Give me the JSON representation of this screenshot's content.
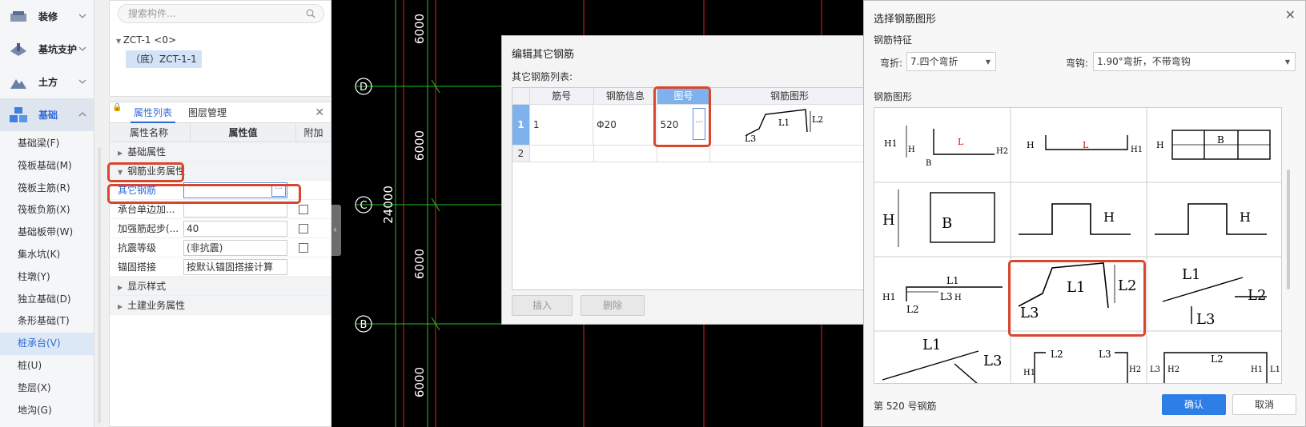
{
  "nav": {
    "categories": [
      {
        "label": "装修",
        "icon": "decoration-icon"
      },
      {
        "label": "基坑支护",
        "icon": "pit-support-icon"
      },
      {
        "label": "土方",
        "icon": "earthwork-icon"
      },
      {
        "label": "基础",
        "icon": "foundation-icon",
        "active": true
      }
    ],
    "items": [
      "基础梁(F)",
      "筏板基础(M)",
      "筏板主筋(R)",
      "筏板负筋(X)",
      "基础板带(W)",
      "集水坑(K)",
      "柱墩(Y)",
      "独立基础(D)",
      "条形基础(T)",
      "桩承台(V)",
      "桩(U)",
      "垫层(X)",
      "地沟(G)"
    ],
    "active_item": "桩承台(V)"
  },
  "tree": {
    "search_placeholder": "搜索构件...",
    "root": "ZCT-1 <0>",
    "child": "（底）ZCT-1-1"
  },
  "props": {
    "tab_attr": "属性列表",
    "tab_layer": "图层管理",
    "col_name": "属性名称",
    "col_value": "属性值",
    "col_add": "附加",
    "group_basic": "基础属性",
    "group_rebar": "钢筋业务属性",
    "rows": {
      "other_rebar": {
        "name": "其它钢筋",
        "value": ""
      },
      "cap_edge": {
        "name": "承台单边加...",
        "value": ""
      },
      "strength_start": {
        "name": "加强筋起步(...",
        "value": "40"
      },
      "seismic": {
        "name": "抗震等级",
        "value": "(非抗震)"
      },
      "anchor": {
        "name": "锚固搭接",
        "value": "按默认锚固搭接计算"
      }
    },
    "group_display": "显示样式",
    "group_civil": "土建业务属性"
  },
  "canvas": {
    "axis_labels": [
      "D",
      "C",
      "B"
    ],
    "dims": [
      "6000",
      "6000",
      "6000",
      "6000"
    ],
    "total_dim": "24000"
  },
  "edit_dialog": {
    "title": "编辑其它钢筋",
    "list_label": "其它钢筋列表:",
    "columns": [
      "筋号",
      "钢筋信息",
      "图号",
      "钢筋图形"
    ],
    "rows": [
      {
        "num": "1",
        "bar_no": "1",
        "info": "Φ20",
        "fig": "520"
      },
      {
        "num": "2",
        "bar_no": "",
        "info": "",
        "fig": ""
      }
    ],
    "insert": "插入",
    "delete": "删除"
  },
  "shape_dialog": {
    "title": "选择钢筋图形",
    "feature_label": "钢筋特征",
    "bend_label": "弯折:",
    "bend_value": "7.四个弯折",
    "hook_label": "弯钩:",
    "hook_value": "1.90°弯折，不带弯钩",
    "shape_label": "钢筋图形",
    "status": "第 520 号钢筋",
    "ok": "确认",
    "cancel": "取消"
  },
  "colors": {
    "accent": "#2d7ee6",
    "highlight": "#d9462e",
    "selected_header": "#7eb2ee"
  }
}
